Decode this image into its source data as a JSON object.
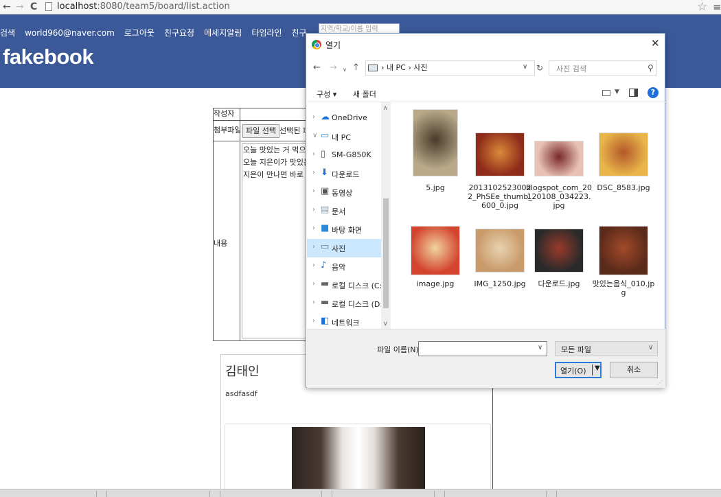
{
  "browser": {
    "url_host": "localhost",
    "url_path": ":8080/team5/board/list.action"
  },
  "header": {
    "nav": [
      "검색",
      "world960@naver.com",
      "로그아웃",
      "친구요청",
      "메세지알림",
      "타임라인",
      "친구"
    ],
    "search_placeholder": "지역/학교/이름 입력",
    "logo": "fakebook"
  },
  "form": {
    "author_label": "작성자",
    "attach_label": "첨부파일",
    "file_button": "파일 선택",
    "file_status": "선택된 파",
    "content_label": "내용",
    "content_lines": [
      "오늘 맛있는 거 먹으로",
      "오늘 지은이가 맛있는",
      "지은이 만나면 바로 출"
    ]
  },
  "post": {
    "author": "김태인",
    "body": "asdfasdf"
  },
  "dialog": {
    "title": "열기",
    "path": [
      "내 PC",
      "사진"
    ],
    "search_placeholder": "사진 검색",
    "toolbar": {
      "organize": "구성 ▾",
      "new_folder": "새 폴더"
    },
    "nav_items": [
      {
        "label": "OneDrive",
        "icon": "cloud-icon",
        "color": "#1e6fd8",
        "expanded": false
      },
      {
        "label": "내 PC",
        "icon": "computer-icon",
        "color": "#2b8ad8",
        "expanded": true
      },
      {
        "label": "SM-G850K",
        "icon": "phone-icon",
        "color": "#555555",
        "expanded": false
      },
      {
        "label": "다운로드",
        "icon": "download-icon",
        "color": "#1e6fd8",
        "expanded": false
      },
      {
        "label": "동영상",
        "icon": "video-icon",
        "color": "#555555",
        "expanded": false
      },
      {
        "label": "문서",
        "icon": "document-icon",
        "color": "#8aa0b8",
        "expanded": false
      },
      {
        "label": "바탕 화면",
        "icon": "desktop-icon",
        "color": "#2b8ad8",
        "expanded": false
      },
      {
        "label": "사진",
        "icon": "pictures-icon",
        "color": "#6b7c8c",
        "expanded": false,
        "selected": true
      },
      {
        "label": "음악",
        "icon": "music-icon",
        "color": "#1e6fd8",
        "expanded": false
      },
      {
        "label": "로컬 디스크 (C:)",
        "icon": "disk-icon",
        "color": "#666666",
        "expanded": false
      },
      {
        "label": "로컬 디스크 (D:)",
        "icon": "disk-icon",
        "color": "#666666",
        "expanded": false
      },
      {
        "label": "네트워크",
        "icon": "network-icon",
        "color": "#1e6fd8",
        "expanded": false
      }
    ],
    "files": [
      {
        "name": "5.jpg",
        "color_a": "#b9a98a",
        "color_b": "#4a3a2a"
      },
      {
        "name": "20131025230022_PhSEe_thumb_600_0.jpg",
        "color_a": "#8e2b1a",
        "color_b": "#d98a3a"
      },
      {
        "name": "blogspot_com_20120108_034223.jpg",
        "color_a": "#e8c2b4",
        "color_b": "#7a2a2a"
      },
      {
        "name": "DSC_8583.jpg",
        "color_a": "#e9b54a",
        "color_b": "#b3582a"
      },
      {
        "name": "image.jpg",
        "color_a": "#d3432e",
        "color_b": "#f0d3a0"
      },
      {
        "name": "IMG_1250.jpg",
        "color_a": "#c99a6a",
        "color_b": "#e8d3b0"
      },
      {
        "name": "다운로드.jpg",
        "color_a": "#2a2a2a",
        "color_b": "#9a3a2a"
      },
      {
        "name": "맛있는음식_010.jpg",
        "color_a": "#5a2a1a",
        "color_b": "#a34a2a"
      }
    ],
    "filename_label": "파일 이름(N):",
    "filename_value": "",
    "filetype": "모든 파일",
    "open_label": "열기(O)",
    "cancel_label": "취소"
  }
}
